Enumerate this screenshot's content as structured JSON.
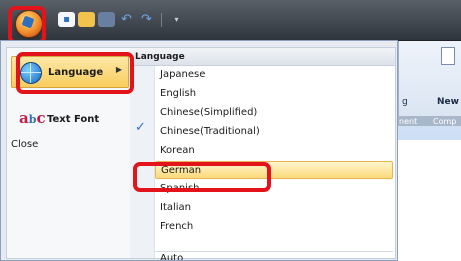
{
  "quick_access": {
    "icons": [
      "new-file-icon",
      "open-folder-icon",
      "save-icon",
      "undo-icon",
      "redo-icon",
      "customize-dropdown-icon"
    ]
  },
  "app_menu": {
    "left_items": [
      {
        "label": "Language",
        "icon": "globe-icon",
        "has_submenu": true
      },
      {
        "label": "Text Font",
        "icon": "abc-font-icon"
      },
      {
        "label": "Close"
      }
    ],
    "submenu": {
      "header": "Language",
      "items": [
        "Japanese",
        "English",
        "Chinese(Simplified)",
        "Chinese(Traditional)",
        "Korean",
        "German",
        "Spanish",
        "Italian",
        "French",
        "Auto"
      ],
      "checked": "English",
      "highlighted": "German"
    }
  },
  "ribbon": {
    "partial_label_1": "g",
    "new_label": "New",
    "group_label_1": "nent",
    "group_label_2": "Comp"
  },
  "colors": {
    "highlight_box": "#e2131b",
    "hover_fill": "#fbd97a",
    "check": "#2d73c9"
  }
}
